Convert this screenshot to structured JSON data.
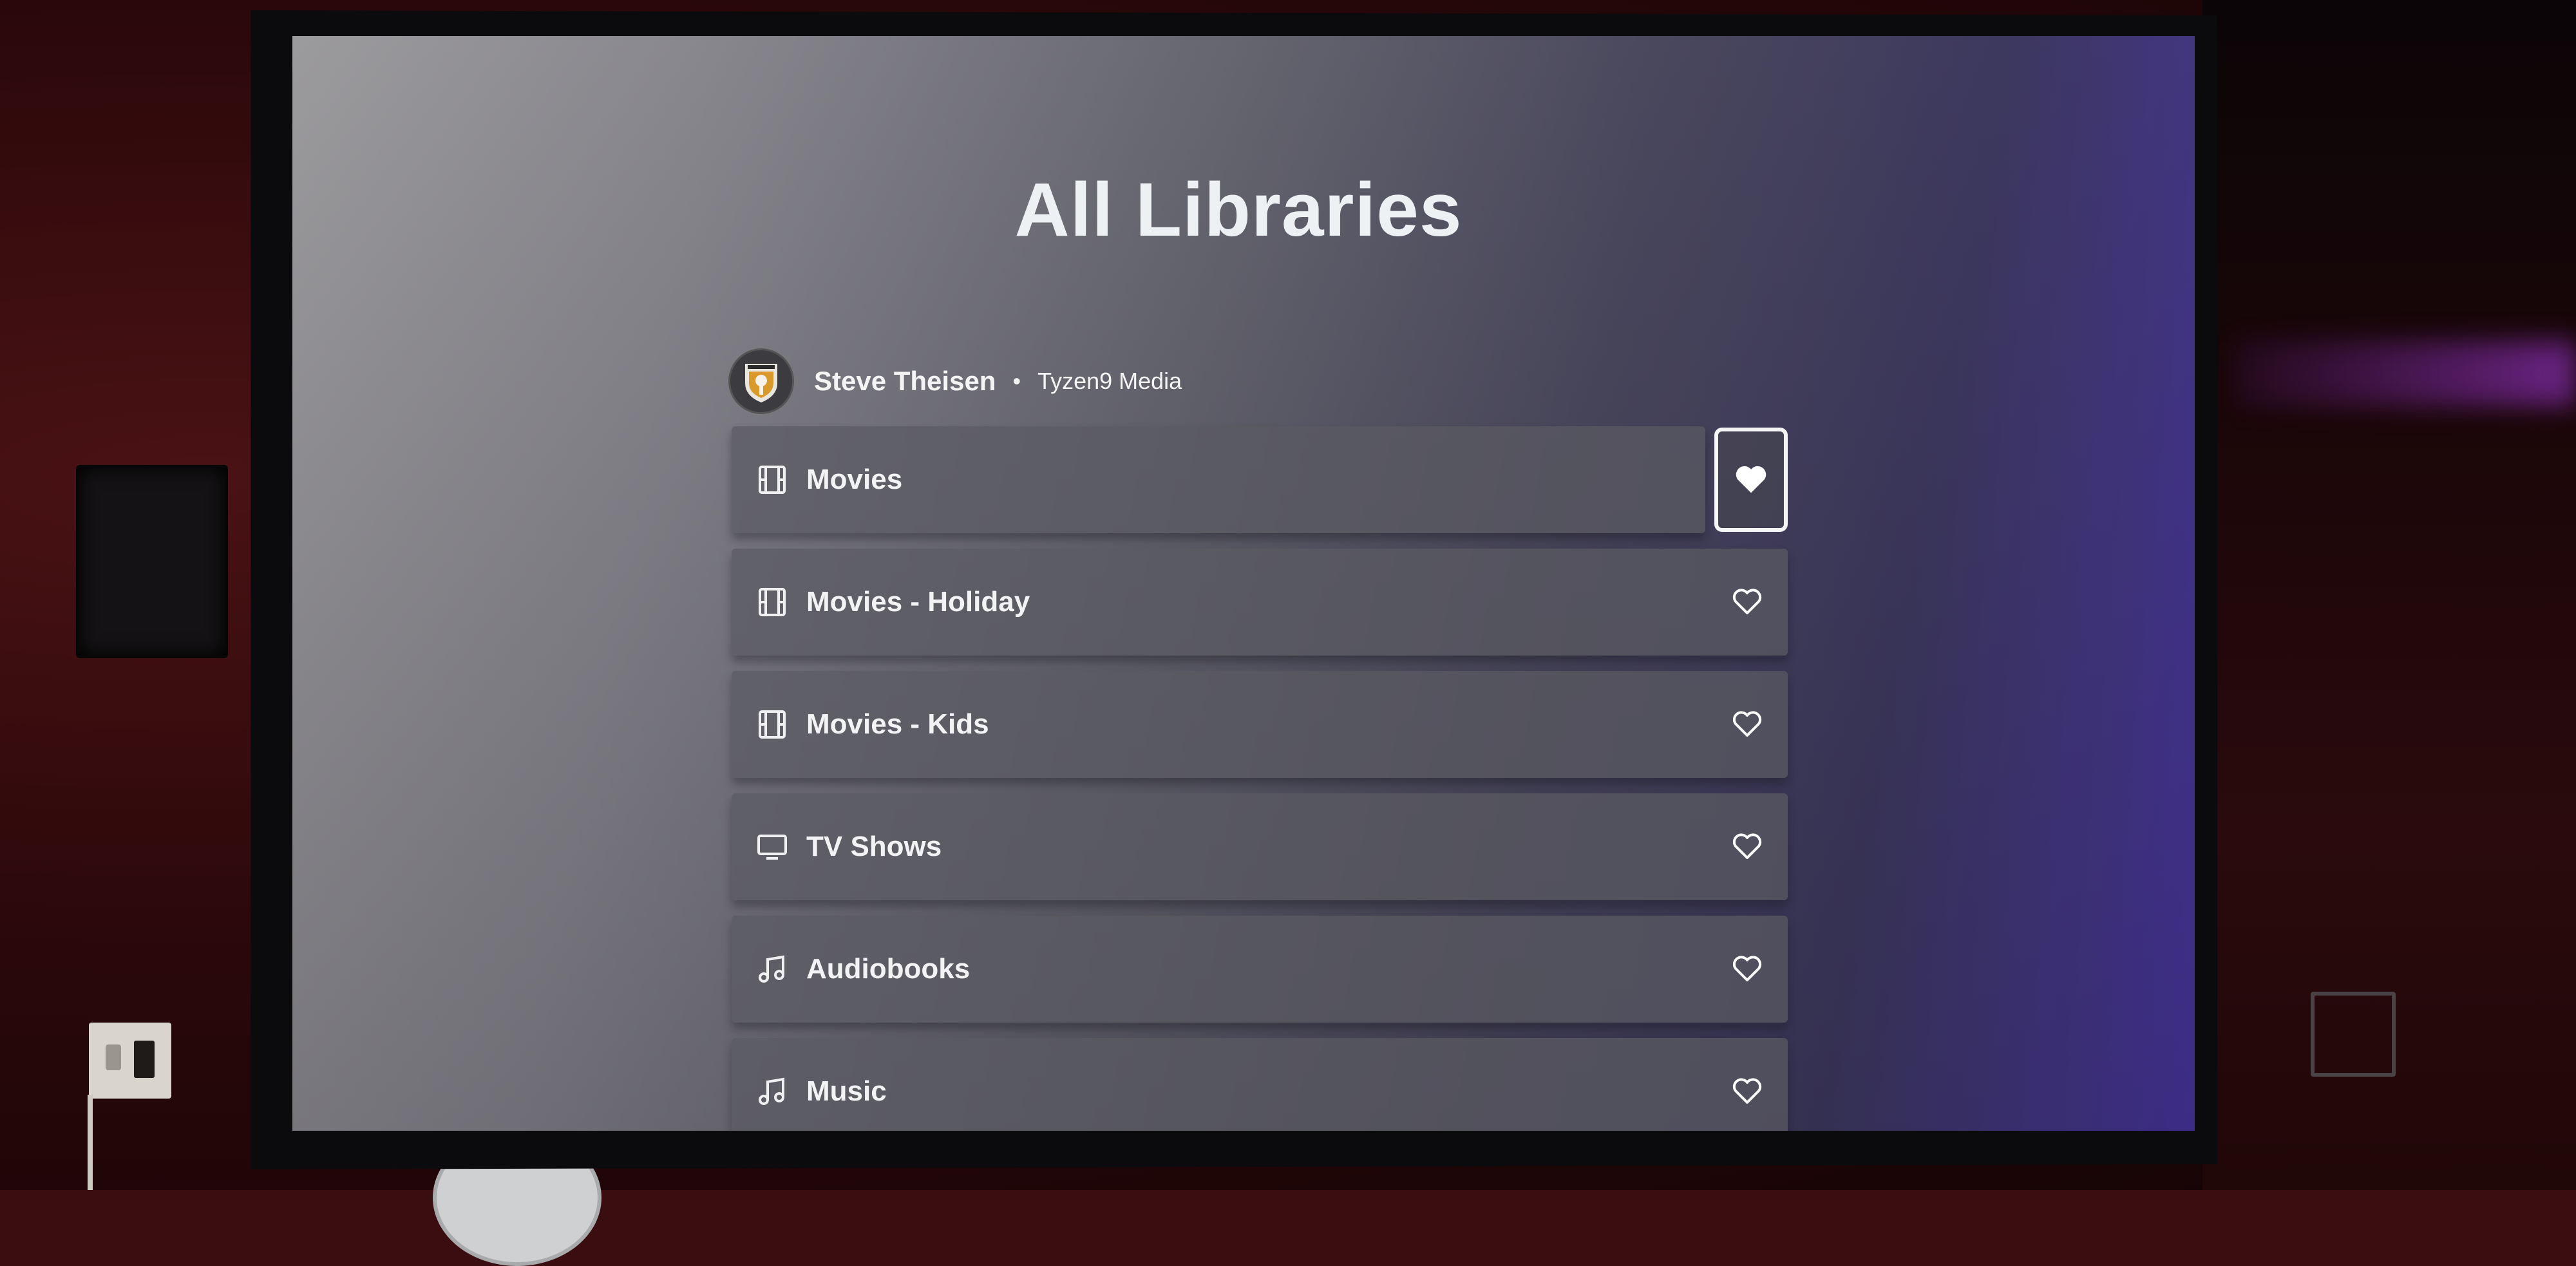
{
  "page": {
    "title": "All Libraries"
  },
  "header": {
    "user_name": "Steve Theisen",
    "separator": "•",
    "server_name": "Tyzen9 Media",
    "avatar_icon": "tyzen9-logo-icon"
  },
  "libraries": [
    {
      "label": "Movies",
      "icon": "film-icon",
      "favorite": true,
      "focused": true
    },
    {
      "label": "Movies - Holiday",
      "icon": "film-icon",
      "favorite": false,
      "focused": false
    },
    {
      "label": "Movies - Kids",
      "icon": "film-icon",
      "favorite": false,
      "focused": false
    },
    {
      "label": "TV Shows",
      "icon": "tv-icon",
      "favorite": false,
      "focused": false
    },
    {
      "label": "Audiobooks",
      "icon": "music-note-icon",
      "favorite": false,
      "focused": false
    },
    {
      "label": "Music",
      "icon": "music-note-icon",
      "favorite": false,
      "focused": false
    }
  ],
  "colors": {
    "screen_accent": "#4a35a8",
    "row_background": "#5a5a62",
    "text": "#f3f3f5"
  }
}
